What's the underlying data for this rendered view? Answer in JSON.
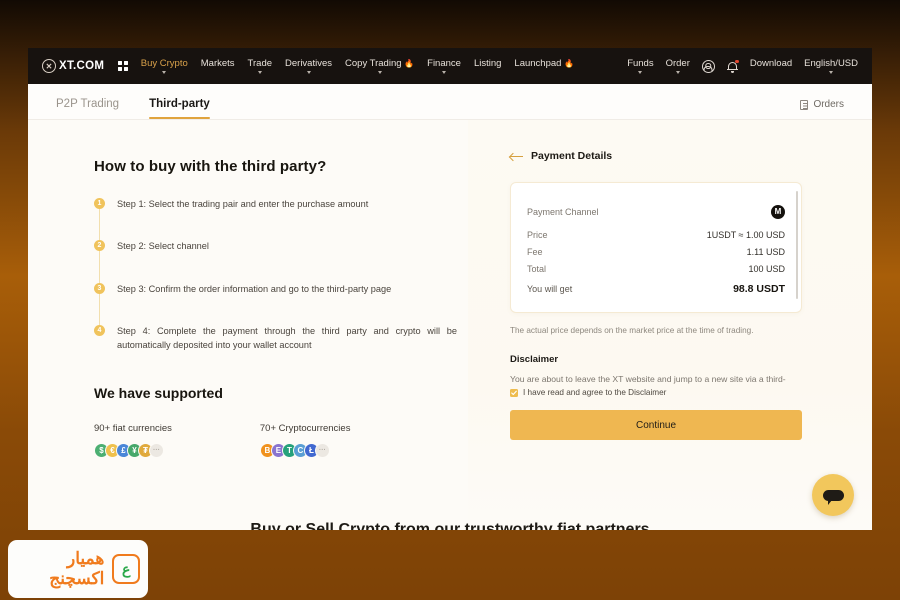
{
  "navbar": {
    "logo_text": "XT.COM",
    "logo_icon": "xt-circle-logo",
    "apps_icon": "grid-apps-icon",
    "links": [
      {
        "label": "Buy Crypto",
        "accent": true,
        "caret": true,
        "flame": false
      },
      {
        "label": "Markets",
        "accent": false,
        "caret": false,
        "flame": false
      },
      {
        "label": "Trade",
        "accent": false,
        "caret": true,
        "flame": false
      },
      {
        "label": "Derivatives",
        "accent": false,
        "caret": true,
        "flame": false
      },
      {
        "label": "Copy Trading",
        "accent": false,
        "caret": true,
        "flame": true
      },
      {
        "label": "Finance",
        "accent": false,
        "caret": true,
        "flame": false
      },
      {
        "label": "Listing",
        "accent": false,
        "caret": false,
        "flame": false
      },
      {
        "label": "Launchpad",
        "accent": false,
        "caret": false,
        "flame": true
      }
    ],
    "right": [
      {
        "label": "Funds",
        "caret": true
      },
      {
        "label": "Order",
        "caret": true
      }
    ],
    "download_label": "Download",
    "locale_label": "English/USD"
  },
  "tabs": {
    "items": [
      {
        "label": "P2P Trading",
        "active": false
      },
      {
        "label": "Third-party",
        "active": true
      }
    ],
    "orders_label": "Orders"
  },
  "left": {
    "title": "How to buy with the third party?",
    "steps": [
      {
        "num": "1",
        "text": "Step 1: Select the trading pair and enter the purchase amount"
      },
      {
        "num": "2",
        "text": "Step 2: Select channel"
      },
      {
        "num": "3",
        "text": "Step 3: Confirm the order information and go to the third-party page"
      },
      {
        "num": "4",
        "text": "Step 4: Complete the payment through the third party and crypto will be automatically deposited into your wallet account"
      }
    ],
    "supported_title": "We have supported",
    "fiat": {
      "label": "90+ fiat currencies",
      "coins": [
        {
          "symbol": "$",
          "color": "#4caf72"
        },
        {
          "symbol": "€",
          "color": "#efc14d"
        },
        {
          "symbol": "£",
          "color": "#4a86d8"
        },
        {
          "symbol": "¥",
          "color": "#47a86b"
        },
        {
          "symbol": "₮",
          "color": "#e0a93c"
        },
        {
          "symbol": "···",
          "color": "#ece8e2"
        }
      ]
    },
    "crypto": {
      "label": "70+ Cryptocurrencies",
      "coins": [
        {
          "symbol": "B",
          "color": "#f0921e"
        },
        {
          "symbol": "E",
          "color": "#8a74cf"
        },
        {
          "symbol": "T",
          "color": "#26a17b"
        },
        {
          "symbol": "C",
          "color": "#5a9fd4"
        },
        {
          "symbol": "Ł",
          "color": "#4168d0"
        },
        {
          "symbol": "···",
          "color": "#ece8e2"
        }
      ]
    }
  },
  "payment": {
    "back_icon": "back-arrow-icon",
    "title": "Payment Details",
    "channel_label": "Payment Channel",
    "channel_logo": "M",
    "rows": [
      {
        "key": "Price",
        "value": "1USDT ≈ 1.00 USD"
      },
      {
        "key": "Fee",
        "value": "1.11 USD"
      },
      {
        "key": "Total",
        "value": "100 USD"
      }
    ],
    "get_label": "You will get",
    "get_value": "98.8 USDT",
    "note": "The actual price depends on the market price at the time of trading.",
    "disclaimer_title": "Disclaimer",
    "disclaimer_body": "You are about to leave the XT website and jump to a new site via a third-",
    "agree_label": "I have read and agree to the Disclaimer",
    "agree_checked": true,
    "continue_label": "Continue"
  },
  "bottom_heading": "Buy or Sell Crypto from our trustworthy fiat partners",
  "chat": {
    "icon": "chat-bubble-icon"
  },
  "watermark": {
    "text": "همیار اکسچنج",
    "logo_glyph": "ع"
  },
  "colors": {
    "accent_gold": "#e0a33c",
    "button_gold": "#efb751",
    "nav_dark": "#17120f",
    "page_bg": "#fdfbf7"
  }
}
